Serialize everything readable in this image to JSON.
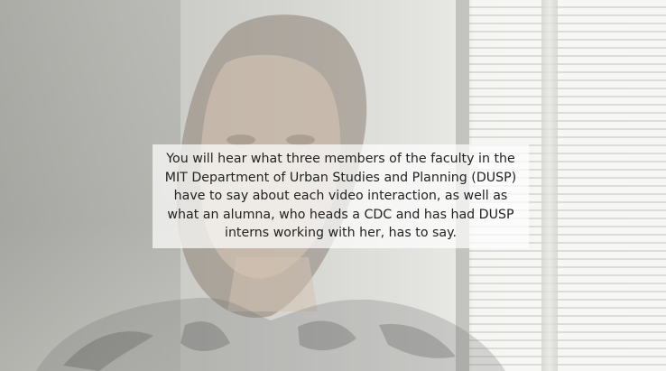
{
  "caption": {
    "text": "You will hear what three members of the faculty in the MIT Department of Urban Studies and Planning (DUSP) have to say about each video interaction, as well as what an alumna, who heads a CDC and has had DUSP interns working with her, has to say."
  },
  "colors": {
    "overlay_bg": "#ffffffb3",
    "caption_text": "#222222"
  }
}
